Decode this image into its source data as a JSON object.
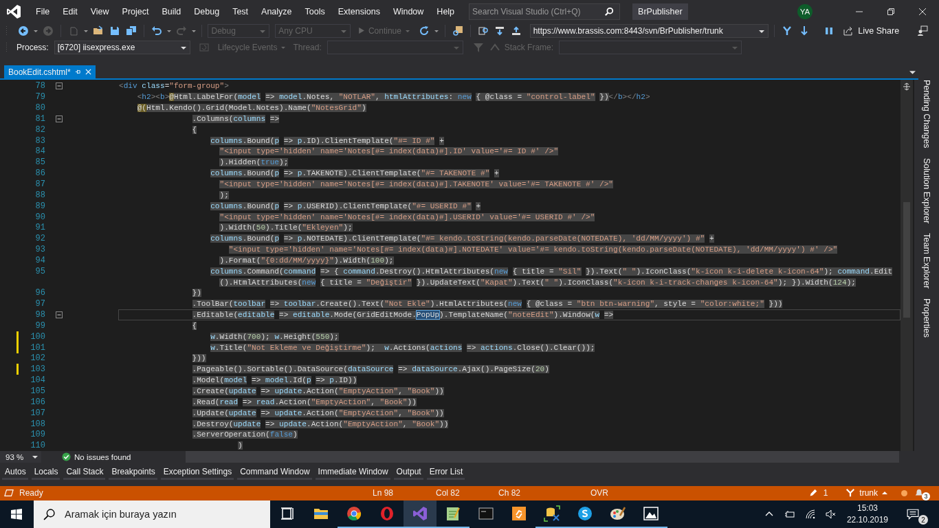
{
  "menu": [
    "File",
    "Edit",
    "View",
    "Project",
    "Build",
    "Debug",
    "Test",
    "Analyze",
    "Tools",
    "Extensions",
    "Window",
    "Help"
  ],
  "search": {
    "placeholder": "Search Visual Studio (Ctrl+Q)"
  },
  "solution_title": "BrPublisher",
  "account": {
    "initials": "YA"
  },
  "toolbar": {
    "configuration": {
      "value": "Debug",
      "disabled": true
    },
    "platform": {
      "value": "Any CPU",
      "disabled": true
    },
    "continue": {
      "label": "Continue",
      "disabled": true
    },
    "repository": {
      "value": "https://www.brassis.com:8443/svn/BrPublisher/trunk"
    },
    "live_share": "Live Share"
  },
  "debug_location": {
    "process_label": "Process:",
    "process": "[6720] iisexpress.exe",
    "lifecycle": {
      "label": "Lifecycle Events",
      "disabled": true
    },
    "thread_label": "Thread:",
    "stack_frame_label": "Stack Frame:"
  },
  "tabs": [
    {
      "label": "BookEdit.cshtml*",
      "selected": true
    }
  ],
  "side_tabs": [
    "Pending Changes",
    "Solution Explorer",
    "Team Explorer",
    "Properties"
  ],
  "editor": {
    "lines": [
      {
        "number": "78",
        "selected": false,
        "modified": false,
        "current": false,
        "foldable": true,
        "tokens": [
          {
            "kind": "bracket",
            "text": "<"
          },
          {
            "kind": "keyword",
            "text": "div"
          },
          {
            "kind": "variable",
            "text": " class"
          },
          {
            "kind": "plain",
            "text": "="
          },
          {
            "kind": "string",
            "text": "\"form-group\""
          },
          {
            "kind": "bracket",
            "text": ">"
          }
        ]
      },
      {
        "number": "79",
        "selected": true,
        "modified": false,
        "current": false,
        "foldable": false,
        "tokens": [
          {
            "kind": "bracket",
            "text": "    <"
          },
          {
            "kind": "keyword",
            "text": "h2"
          },
          {
            "kind": "bracket",
            "text": "><"
          },
          {
            "kind": "keyword",
            "text": "b"
          },
          {
            "kind": "bracket",
            "text": ">"
          },
          {
            "kind": "razor",
            "text": "@"
          },
          {
            "kind": "plain",
            "text": "Html.LabelFor("
          },
          {
            "kind": "variable",
            "text": "model"
          },
          {
            "kind": "plain",
            "text": " => "
          },
          {
            "kind": "variable",
            "text": "model"
          },
          {
            "kind": "plain",
            "text": ".Notes, "
          },
          {
            "kind": "string",
            "text": "\"NOTLAR\""
          },
          {
            "kind": "plain",
            "text": ", "
          },
          {
            "kind": "variable",
            "text": "htmlAttributes"
          },
          {
            "kind": "plain",
            "text": ": "
          },
          {
            "kind": "keyword",
            "text": "new"
          },
          {
            "kind": "plain",
            "text": " { @class = "
          },
          {
            "kind": "string",
            "text": "\"control-label\""
          },
          {
            "kind": "plain",
            "text": " })"
          },
          {
            "kind": "bracket",
            "text": "</"
          },
          {
            "kind": "keyword",
            "text": "b"
          },
          {
            "kind": "bracket",
            "text": "></"
          },
          {
            "kind": "keyword",
            "text": "h2"
          },
          {
            "kind": "bracket",
            "text": ">"
          }
        ]
      },
      {
        "number": "80",
        "selected": true,
        "modified": false,
        "current": false,
        "foldable": false,
        "tokens": [
          {
            "kind": "razor",
            "text": "    @("
          },
          {
            "kind": "plain",
            "text": "Html.Kendo().Grid(Model.Notes).Name("
          },
          {
            "kind": "string",
            "text": "\"NotesGrid\""
          },
          {
            "kind": "plain",
            "text": ")"
          }
        ]
      },
      {
        "number": "81",
        "selected": true,
        "modified": false,
        "current": false,
        "foldable": true,
        "tokens": [
          {
            "kind": "plain",
            "text": "                .Columns("
          },
          {
            "kind": "variable",
            "text": "columns"
          },
          {
            "kind": "plain",
            "text": " =>"
          }
        ]
      },
      {
        "number": "82",
        "selected": true,
        "modified": false,
        "current": false,
        "foldable": false,
        "tokens": [
          {
            "kind": "plain",
            "text": "                {"
          }
        ]
      },
      {
        "number": "83",
        "selected": true,
        "modified": false,
        "current": false,
        "foldable": false,
        "tokens": [
          {
            "kind": "variable",
            "text": "                    columns"
          },
          {
            "kind": "plain",
            "text": ".Bound("
          },
          {
            "kind": "variable",
            "text": "p"
          },
          {
            "kind": "plain",
            "text": " => "
          },
          {
            "kind": "variable",
            "text": "p"
          },
          {
            "kind": "plain",
            "text": ".ID).ClientTemplate("
          },
          {
            "kind": "string",
            "text": "\"#= ID #\""
          },
          {
            "kind": "plain",
            "text": " +"
          }
        ]
      },
      {
        "number": "84",
        "selected": true,
        "modified": false,
        "current": false,
        "foldable": false,
        "tokens": [
          {
            "kind": "string",
            "text": "                      \"<input type='hidden' name='Notes[#= index(data)#].ID' value='#= ID #' />\""
          }
        ]
      },
      {
        "number": "85",
        "selected": true,
        "modified": false,
        "current": false,
        "foldable": false,
        "tokens": [
          {
            "kind": "plain",
            "text": "                      ).Hidden("
          },
          {
            "kind": "keyword",
            "text": "true"
          },
          {
            "kind": "plain",
            "text": ");"
          }
        ]
      },
      {
        "number": "86",
        "selected": true,
        "modified": false,
        "current": false,
        "foldable": false,
        "tokens": [
          {
            "kind": "variable",
            "text": "                    columns"
          },
          {
            "kind": "plain",
            "text": ".Bound("
          },
          {
            "kind": "variable",
            "text": "p"
          },
          {
            "kind": "plain",
            "text": " => "
          },
          {
            "kind": "variable",
            "text": "p"
          },
          {
            "kind": "plain",
            "text": ".TAKENOTE).ClientTemplate("
          },
          {
            "kind": "string",
            "text": "\"#= TAKENOTE #\""
          },
          {
            "kind": "plain",
            "text": " +"
          }
        ]
      },
      {
        "number": "87",
        "selected": true,
        "modified": false,
        "current": false,
        "foldable": false,
        "tokens": [
          {
            "kind": "string",
            "text": "                      \"<input type='hidden' name='Notes[#= index(data)#].TAKENOTE' value='#= TAKENOTE #' />\""
          }
        ]
      },
      {
        "number": "88",
        "selected": true,
        "modified": false,
        "current": false,
        "foldable": false,
        "tokens": [
          {
            "kind": "plain",
            "text": "                      );"
          }
        ]
      },
      {
        "number": "89",
        "selected": true,
        "modified": false,
        "current": false,
        "foldable": false,
        "tokens": [
          {
            "kind": "variable",
            "text": "                    columns"
          },
          {
            "kind": "plain",
            "text": ".Bound("
          },
          {
            "kind": "variable",
            "text": "p"
          },
          {
            "kind": "plain",
            "text": " => "
          },
          {
            "kind": "variable",
            "text": "p"
          },
          {
            "kind": "plain",
            "text": ".USERID).ClientTemplate("
          },
          {
            "kind": "string",
            "text": "\"#= USERID #\""
          },
          {
            "kind": "plain",
            "text": " +"
          }
        ]
      },
      {
        "number": "90",
        "selected": true,
        "modified": false,
        "current": false,
        "foldable": false,
        "tokens": [
          {
            "kind": "string",
            "text": "                      \"<input type='hidden' name='Notes[#= index(data)#].USERID' value='#= USERID #' />\""
          }
        ]
      },
      {
        "number": "91",
        "selected": true,
        "modified": false,
        "current": false,
        "foldable": false,
        "tokens": [
          {
            "kind": "plain",
            "text": "                      ).Width("
          },
          {
            "kind": "number",
            "text": "50"
          },
          {
            "kind": "plain",
            "text": ").Title("
          },
          {
            "kind": "string",
            "text": "\"Ekleyen\""
          },
          {
            "kind": "plain",
            "text": ");"
          }
        ]
      },
      {
        "number": "92",
        "selected": true,
        "modified": false,
        "current": false,
        "foldable": false,
        "tokens": [
          {
            "kind": "variable",
            "text": "                    columns"
          },
          {
            "kind": "plain",
            "text": ".Bound("
          },
          {
            "kind": "variable",
            "text": "p"
          },
          {
            "kind": "plain",
            "text": " => "
          },
          {
            "kind": "variable",
            "text": "p"
          },
          {
            "kind": "plain",
            "text": ".NOTEDATE).ClientTemplate("
          },
          {
            "kind": "string",
            "text": "\"#= kendo.toString(kendo.parseDate(NOTEDATE), 'dd/MM/yyyy') #\""
          },
          {
            "kind": "plain",
            "text": " +"
          }
        ]
      },
      {
        "number": "93",
        "selected": true,
        "modified": false,
        "current": false,
        "foldable": false,
        "tokens": [
          {
            "kind": "string",
            "text": "                        \"<input type='hidden' name='Notes[#= index(data)#].NOTEDATE' value='#= kendo.toString(kendo.parseDate(NOTEDATE), 'dd/MM/yyyy') #' />\""
          }
        ]
      },
      {
        "number": "94",
        "selected": true,
        "modified": false,
        "current": false,
        "foldable": false,
        "tokens": [
          {
            "kind": "plain",
            "text": "                      ).Format("
          },
          {
            "kind": "string",
            "text": "\"{0:dd/MM/yyyy}\""
          },
          {
            "kind": "plain",
            "text": ").Width("
          },
          {
            "kind": "number",
            "text": "100"
          },
          {
            "kind": "plain",
            "text": ");"
          }
        ]
      },
      {
        "number": "95",
        "selected": true,
        "modified": false,
        "current": false,
        "foldable": false,
        "tokens": [
          {
            "kind": "variable",
            "text": "                    columns"
          },
          {
            "kind": "plain",
            "text": ".Command("
          },
          {
            "kind": "variable",
            "text": "command"
          },
          {
            "kind": "plain",
            "text": " => { "
          },
          {
            "kind": "variable",
            "text": "command"
          },
          {
            "kind": "plain",
            "text": ".Destroy().HtmlAttributes("
          },
          {
            "kind": "keyword",
            "text": "new"
          },
          {
            "kind": "plain",
            "text": " { title = "
          },
          {
            "kind": "string",
            "text": "\"Sil\""
          },
          {
            "kind": "plain",
            "text": " }).Text("
          },
          {
            "kind": "string",
            "text": "\" \""
          },
          {
            "kind": "plain",
            "text": ").IconClass("
          },
          {
            "kind": "string",
            "text": "\"k-icon k-i-delete k-icon-64\""
          },
          {
            "kind": "plain",
            "text": "); "
          },
          {
            "kind": "variable",
            "text": "command"
          },
          {
            "kind": "plain",
            "text": ".Edit"
          }
        ]
      },
      {
        "selected": true,
        "modified": false,
        "current": false,
        "foldable": false,
        "tokens": [
          {
            "kind": "plain",
            "text": "                      ().HtmlAttributes("
          },
          {
            "kind": "keyword",
            "text": "new"
          },
          {
            "kind": "plain",
            "text": " { title = "
          },
          {
            "kind": "string",
            "text": "\"Değiştir\""
          },
          {
            "kind": "plain",
            "text": " }).UpdateText("
          },
          {
            "kind": "string",
            "text": "\"Kapat\""
          },
          {
            "kind": "plain",
            "text": ").Text("
          },
          {
            "kind": "string",
            "text": "\" \""
          },
          {
            "kind": "plain",
            "text": ").IconClass("
          },
          {
            "kind": "string",
            "text": "\"k-icon k-i-track-changes k-icon-64\""
          },
          {
            "kind": "plain",
            "text": "); }).Width("
          },
          {
            "kind": "number",
            "text": "124"
          },
          {
            "kind": "plain",
            "text": ");"
          }
        ]
      },
      {
        "number": "96",
        "selected": true,
        "modified": false,
        "current": false,
        "foldable": false,
        "tokens": [
          {
            "kind": "plain",
            "text": "                })"
          }
        ]
      },
      {
        "number": "97",
        "selected": true,
        "modified": false,
        "current": false,
        "foldable": false,
        "tokens": [
          {
            "kind": "plain",
            "text": "                .ToolBar("
          },
          {
            "kind": "variable",
            "text": "toolbar"
          },
          {
            "kind": "plain",
            "text": " => "
          },
          {
            "kind": "variable",
            "text": "toolbar"
          },
          {
            "kind": "plain",
            "text": ".Create().Text("
          },
          {
            "kind": "string",
            "text": "\"Not Ekle\""
          },
          {
            "kind": "plain",
            "text": ").HtmlAttributes("
          },
          {
            "kind": "keyword",
            "text": "new"
          },
          {
            "kind": "plain",
            "text": " { @class = "
          },
          {
            "kind": "string",
            "text": "\"btn btn-warning\""
          },
          {
            "kind": "plain",
            "text": ", style = "
          },
          {
            "kind": "string",
            "text": "\"color:white;\""
          },
          {
            "kind": "plain",
            "text": " }))"
          }
        ]
      },
      {
        "number": "98",
        "selected": true,
        "modified": false,
        "current": true,
        "foldable": true,
        "tokens": [
          {
            "kind": "plain",
            "text": "                .Editable("
          },
          {
            "kind": "variable",
            "text": "editable"
          },
          {
            "kind": "plain",
            "text": " => "
          },
          {
            "kind": "variable",
            "text": "editable"
          },
          {
            "kind": "plain",
            "text": ".Mode(GridEditMode."
          },
          {
            "kind": "match",
            "text": "PopUp"
          },
          {
            "kind": "plain",
            "text": ").TemplateName("
          },
          {
            "kind": "string",
            "text": "\"noteEdit\""
          },
          {
            "kind": "plain",
            "text": ").Window("
          },
          {
            "kind": "variable",
            "text": "w"
          },
          {
            "kind": "plain",
            "text": " =>"
          }
        ]
      },
      {
        "number": "99",
        "selected": true,
        "modified": false,
        "current": false,
        "foldable": false,
        "tokens": [
          {
            "kind": "plain",
            "text": "                {"
          }
        ]
      },
      {
        "number": "100",
        "selected": true,
        "modified": true,
        "current": false,
        "foldable": false,
        "tokens": [
          {
            "kind": "variable",
            "text": "                    w"
          },
          {
            "kind": "plain",
            "text": ".Width("
          },
          {
            "kind": "number",
            "text": "700"
          },
          {
            "kind": "plain",
            "text": "); "
          },
          {
            "kind": "variable",
            "text": "w"
          },
          {
            "kind": "plain",
            "text": ".Height("
          },
          {
            "kind": "number",
            "text": "550"
          },
          {
            "kind": "plain",
            "text": ");"
          }
        ]
      },
      {
        "number": "101",
        "selected": true,
        "modified": true,
        "current": false,
        "foldable": false,
        "tokens": [
          {
            "kind": "variable",
            "text": "                    w"
          },
          {
            "kind": "plain",
            "text": ".Title("
          },
          {
            "kind": "string",
            "text": "\"Not Ekleme ve Değiştirme\""
          },
          {
            "kind": "plain",
            "text": ");  "
          },
          {
            "kind": "variable",
            "text": "w"
          },
          {
            "kind": "plain",
            "text": ".Actions("
          },
          {
            "kind": "variable",
            "text": "actions"
          },
          {
            "kind": "plain",
            "text": " => "
          },
          {
            "kind": "variable",
            "text": "actions"
          },
          {
            "kind": "plain",
            "text": ".Close().Clear());"
          }
        ]
      },
      {
        "number": "102",
        "selected": true,
        "modified": false,
        "current": false,
        "foldable": false,
        "tokens": [
          {
            "kind": "plain",
            "text": "                }))"
          }
        ]
      },
      {
        "number": "103",
        "selected": true,
        "modified": true,
        "current": false,
        "foldable": false,
        "tokens": [
          {
            "kind": "plain",
            "text": "                .Pageable().Sortable().DataSource("
          },
          {
            "kind": "variable",
            "text": "dataSource"
          },
          {
            "kind": "plain",
            "text": " => "
          },
          {
            "kind": "variable",
            "text": "dataSource"
          },
          {
            "kind": "plain",
            "text": ".Ajax().PageSize("
          },
          {
            "kind": "number",
            "text": "20"
          },
          {
            "kind": "plain",
            "text": ")"
          }
        ]
      },
      {
        "number": "104",
        "selected": true,
        "modified": false,
        "current": false,
        "foldable": false,
        "tokens": [
          {
            "kind": "plain",
            "text": "                .Model("
          },
          {
            "kind": "variable",
            "text": "model"
          },
          {
            "kind": "plain",
            "text": " => "
          },
          {
            "kind": "variable",
            "text": "model"
          },
          {
            "kind": "plain",
            "text": ".Id("
          },
          {
            "kind": "variable",
            "text": "p"
          },
          {
            "kind": "plain",
            "text": " => "
          },
          {
            "kind": "variable",
            "text": "p"
          },
          {
            "kind": "plain",
            "text": ".ID))"
          }
        ]
      },
      {
        "number": "105",
        "selected": true,
        "modified": false,
        "current": false,
        "foldable": false,
        "tokens": [
          {
            "kind": "plain",
            "text": "                .Create("
          },
          {
            "kind": "variable",
            "text": "update"
          },
          {
            "kind": "plain",
            "text": " => "
          },
          {
            "kind": "variable",
            "text": "update"
          },
          {
            "kind": "plain",
            "text": ".Action("
          },
          {
            "kind": "string",
            "text": "\"EmptyAction\""
          },
          {
            "kind": "plain",
            "text": ", "
          },
          {
            "kind": "string",
            "text": "\"Book\""
          },
          {
            "kind": "plain",
            "text": "))"
          }
        ]
      },
      {
        "number": "106",
        "selected": true,
        "modified": false,
        "current": false,
        "foldable": false,
        "tokens": [
          {
            "kind": "plain",
            "text": "                .Read("
          },
          {
            "kind": "variable",
            "text": "read"
          },
          {
            "kind": "plain",
            "text": " => "
          },
          {
            "kind": "variable",
            "text": "read"
          },
          {
            "kind": "plain",
            "text": ".Action("
          },
          {
            "kind": "string",
            "text": "\"EmptyAction\""
          },
          {
            "kind": "plain",
            "text": ", "
          },
          {
            "kind": "string",
            "text": "\"Book\""
          },
          {
            "kind": "plain",
            "text": "))"
          }
        ]
      },
      {
        "number": "107",
        "selected": true,
        "modified": false,
        "current": false,
        "foldable": false,
        "tokens": [
          {
            "kind": "plain",
            "text": "                .Update("
          },
          {
            "kind": "variable",
            "text": "update"
          },
          {
            "kind": "plain",
            "text": " => "
          },
          {
            "kind": "variable",
            "text": "update"
          },
          {
            "kind": "plain",
            "text": ".Action("
          },
          {
            "kind": "string",
            "text": "\"EmptyAction\""
          },
          {
            "kind": "plain",
            "text": ", "
          },
          {
            "kind": "string",
            "text": "\"Book\""
          },
          {
            "kind": "plain",
            "text": "))"
          }
        ]
      },
      {
        "number": "108",
        "selected": true,
        "modified": false,
        "current": false,
        "foldable": false,
        "tokens": [
          {
            "kind": "plain",
            "text": "                .Destroy("
          },
          {
            "kind": "variable",
            "text": "update"
          },
          {
            "kind": "plain",
            "text": " => "
          },
          {
            "kind": "variable",
            "text": "update"
          },
          {
            "kind": "plain",
            "text": ".Action("
          },
          {
            "kind": "string",
            "text": "\"EmptyAction\""
          },
          {
            "kind": "plain",
            "text": ", "
          },
          {
            "kind": "string",
            "text": "\"Book\""
          },
          {
            "kind": "plain",
            "text": "))"
          }
        ]
      },
      {
        "number": "109",
        "selected": true,
        "modified": false,
        "current": false,
        "foldable": false,
        "tokens": [
          {
            "kind": "plain",
            "text": "                .ServerOperation("
          },
          {
            "kind": "keyword",
            "text": "false"
          },
          {
            "kind": "plain",
            "text": ")"
          }
        ]
      },
      {
        "number": "110",
        "selected": true,
        "modified": false,
        "current": false,
        "foldable": false,
        "tokens": [
          {
            "kind": "plain",
            "text": "                          )"
          }
        ]
      }
    ],
    "zoom": "93 %",
    "issues": "No issues found"
  },
  "tool_tabs": [
    "Autos",
    "Locals",
    "Call Stack",
    "Breakpoints",
    "Exception Settings",
    "Command Window",
    "Immediate Window",
    "Output",
    "Error List"
  ],
  "status_bar": {
    "state": "Ready",
    "line": "Ln 98",
    "column": "Col 82",
    "char": "Ch 82",
    "mode": "OVR",
    "pending_edits": "1",
    "branch": "trunk",
    "notifications": "3"
  },
  "taskbar": {
    "search_placeholder": "Aramak için buraya yazın",
    "apps": [
      {
        "kind": "taskview",
        "running": false,
        "selected": false
      },
      {
        "kind": "explorer",
        "running": false,
        "selected": false
      },
      {
        "kind": "chrome",
        "running": true,
        "selected": false
      },
      {
        "kind": "opera",
        "running": true,
        "selected": false
      },
      {
        "kind": "vs",
        "running": true,
        "selected": true
      },
      {
        "kind": "notepad",
        "running": true,
        "selected": false
      },
      {
        "kind": "terminal",
        "running": false,
        "selected": false
      },
      {
        "kind": "sync",
        "running": false,
        "selected": false
      },
      {
        "kind": "dbtool",
        "running": true,
        "selected": false
      },
      {
        "kind": "skype",
        "running": true,
        "selected": false
      },
      {
        "kind": "paint",
        "running": true,
        "selected": false
      },
      {
        "kind": "photos",
        "running": true,
        "selected": false
      }
    ],
    "time": "15:03",
    "date": "22.10.2019",
    "notifications": "2"
  }
}
